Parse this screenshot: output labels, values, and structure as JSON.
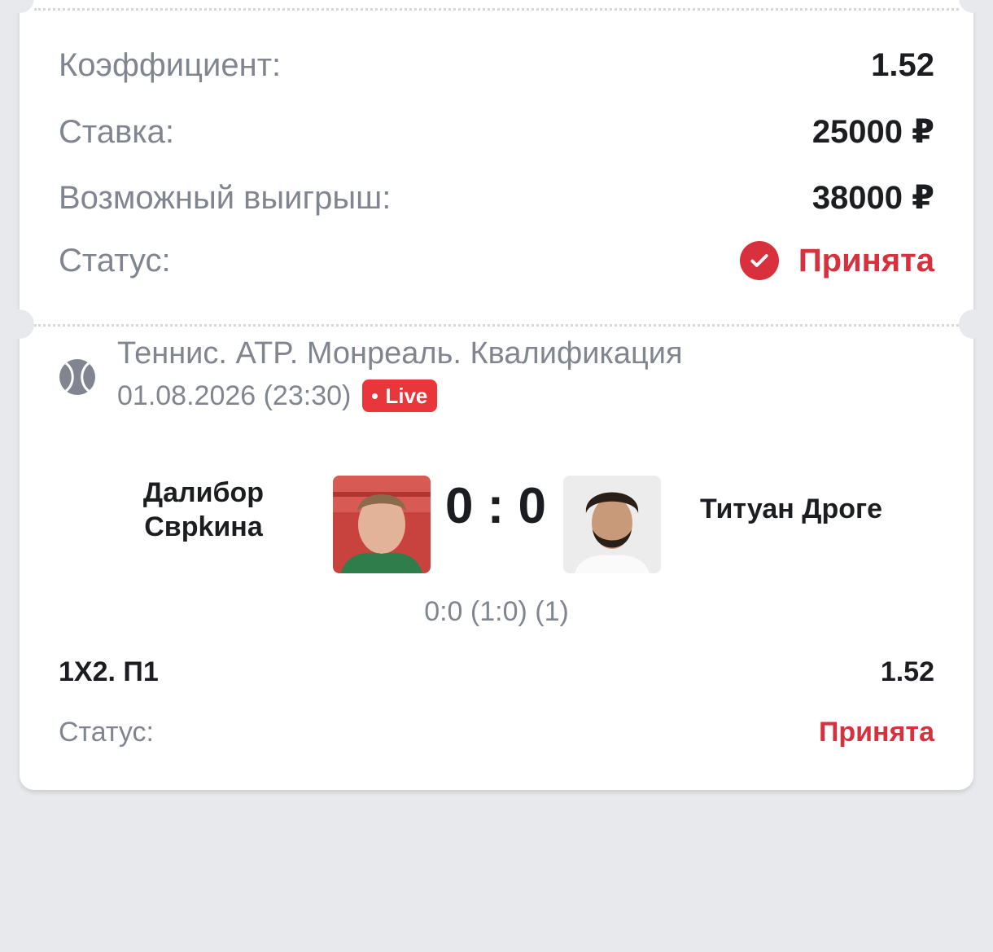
{
  "summary": {
    "coefficient_label": "Коэффициент:",
    "coefficient_value": "1.52",
    "stake_label": "Ставка:",
    "stake_value": "25000 ₽",
    "win_label": "Возможный выигрыш:",
    "win_value": "38000 ₽",
    "status_label": "Статус:",
    "status_value": "Принята",
    "status_icon": "check-circle-icon"
  },
  "event": {
    "sport_icon": "tennis-ball-icon",
    "title": "Теннис. ATP. Монреаль. Квалификация",
    "datetime": "01.08.2026 (23:30)",
    "live_label": "Live",
    "player1": "Далибор Сврkина",
    "player2": "Титуан Дроге",
    "score": "0 : 0",
    "sets": "0:0 (1:0) (1)"
  },
  "bet": {
    "type": "1X2. П1",
    "odd": "1.52",
    "status_label": "Статус:",
    "status_value": "Принята"
  },
  "colors": {
    "accent_red": "#d8303c",
    "live_red": "#e8363b",
    "muted_text": "#80858f",
    "background": "#e8e9ec"
  }
}
